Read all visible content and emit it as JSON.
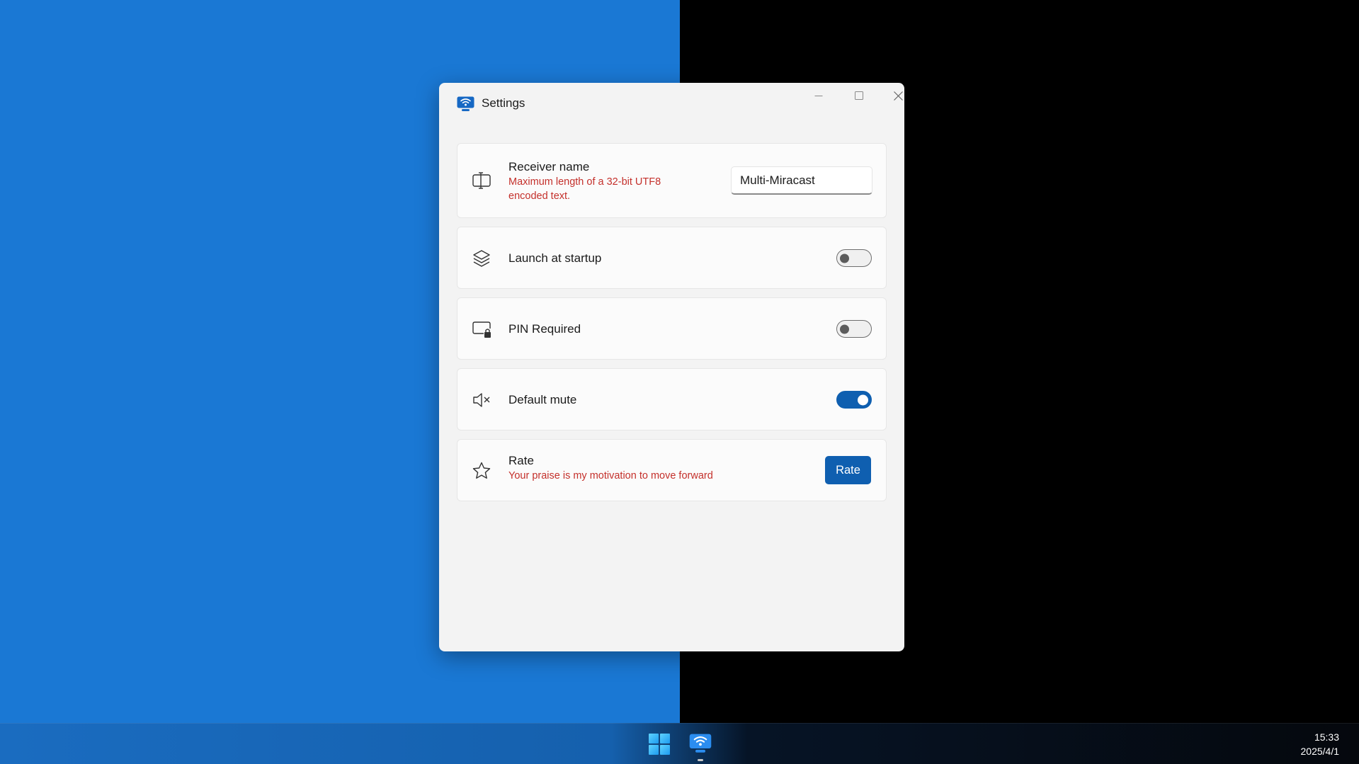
{
  "window": {
    "title": "Settings",
    "icon": "cast-display-icon",
    "controls": {
      "minimize": "minimize-icon",
      "maximize": "maximize-icon",
      "close": "close-icon"
    }
  },
  "settings": {
    "receiver_name": {
      "title": "Receiver name",
      "description": "Maximum length of a 32-bit UTF8 encoded text.",
      "value": "Multi-Miracast",
      "icon": "rename-icon"
    },
    "launch_at_startup": {
      "title": "Launch at startup",
      "enabled": false,
      "icon": "layers-icon"
    },
    "pin_required": {
      "title": "PIN Required",
      "enabled": false,
      "icon": "screen-lock-icon"
    },
    "default_mute": {
      "title": "Default mute",
      "enabled": true,
      "icon": "mute-icon"
    },
    "rate": {
      "title": "Rate",
      "description": "Your praise is my motivation to move forward",
      "button_label": "Rate",
      "icon": "star-icon"
    }
  },
  "taskbar": {
    "time": "15:33",
    "date": "2025/4/1",
    "start_icon": "windows-logo-icon",
    "app_icon": "cast-display-icon"
  },
  "colors": {
    "accent": "#0f5fb0",
    "description_text": "#c4302b",
    "desktop_left": "#1a78d4",
    "desktop_right": "#000000"
  }
}
